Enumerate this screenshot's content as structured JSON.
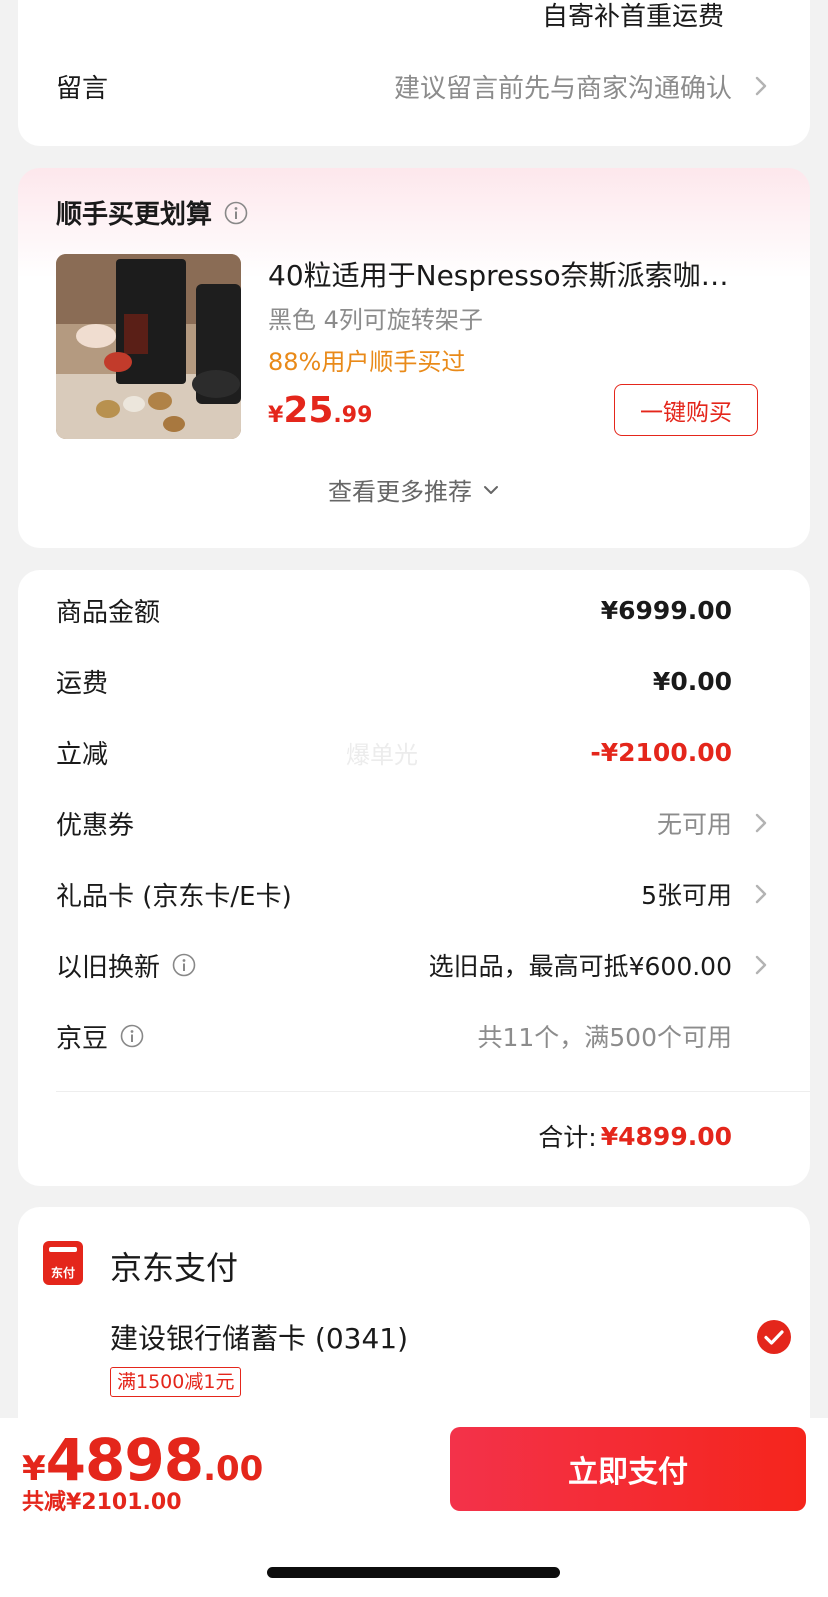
{
  "note_section": {
    "shipping_text": "自寄补首重运费",
    "message_label": "留言",
    "message_placeholder": "建议留言前先与商家沟通确认"
  },
  "addon_section": {
    "title": "顺手买更划算",
    "product": {
      "name": "40粒适用于Nespresso奈斯派索咖…",
      "spec": "黑色 4列可旋转架子",
      "social_proof": "88%用户顺手买过",
      "price_symbol": "¥",
      "price_int": "25",
      "price_dec": ".99",
      "buy_button": "一键购买"
    },
    "more_label": "查看更多推荐"
  },
  "summary": {
    "rows": [
      {
        "label": "商品金额",
        "value": "¥6999.00"
      },
      {
        "label": "运费",
        "value": "¥0.00"
      },
      {
        "label": "立减",
        "value": "-¥2100.00"
      },
      {
        "label": "优惠券",
        "value": "无可用"
      },
      {
        "label": "礼品卡 (京东卡/E卡)",
        "value": "5张可用"
      },
      {
        "label": "以旧换新",
        "value": "选旧品，最高可抵¥600.00"
      },
      {
        "label": "京豆",
        "value": "共11个，满500个可用"
      }
    ],
    "watermark": "爆单光",
    "total_label": "合计:",
    "total_value": "¥4899.00"
  },
  "payment": {
    "method_label": "京东支付",
    "icon_text": "东付",
    "card_label": "建设银行储蓄卡 (0341)",
    "promo_tag": "满1500减1元"
  },
  "bottom_bar": {
    "symbol": "¥",
    "amount_int": "4898",
    "amount_dec": ".00",
    "saving_text": "共减¥2101.00",
    "pay_button": "立即支付"
  },
  "colors": {
    "accent_red": "#e4261b",
    "orange": "#e98a19",
    "muted": "#8c8c8c"
  }
}
